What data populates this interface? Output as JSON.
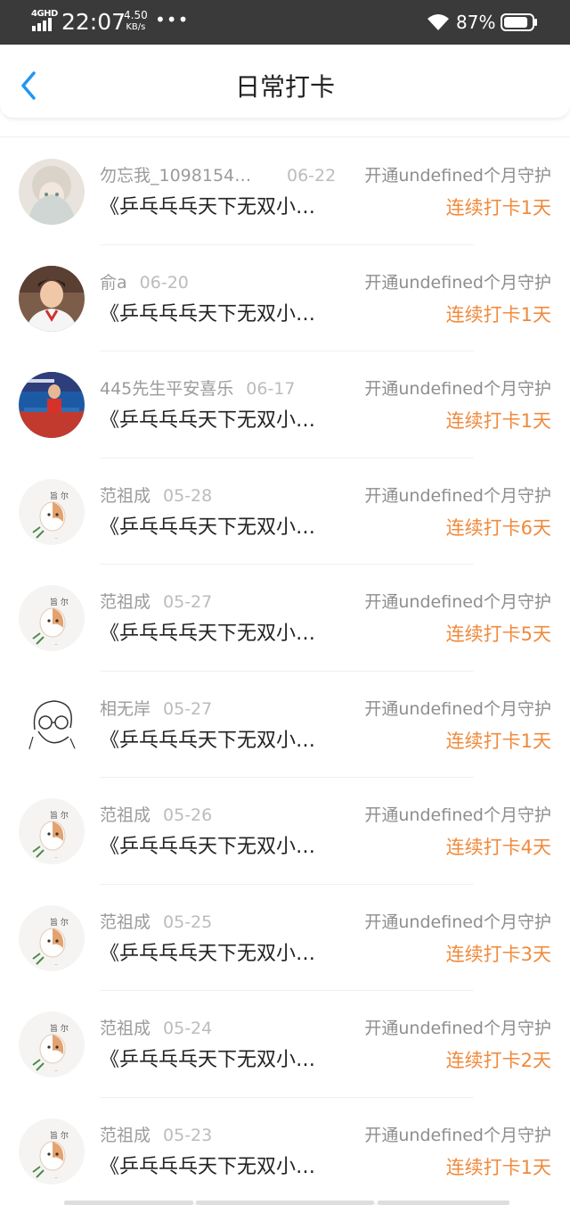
{
  "status_bar": {
    "network": "4GHD",
    "time": "22:07",
    "speed_value": "4.50",
    "speed_unit": "KB/s",
    "more": "•••",
    "battery": "87%",
    "battery_level": 0.87
  },
  "header": {
    "title": "日常打卡",
    "back_icon": "chevron-left-icon"
  },
  "colors": {
    "accent_blue": "#2196f3",
    "streak_orange": "#f08a3c"
  },
  "checkins": [
    {
      "user": "勿忘我_1098154…",
      "date": "06-22",
      "book": "《乒乓乓乓天下无双小…",
      "membership": "开通undefined个月守护",
      "streak": "连续打卡1天",
      "avatar": "anime-girl-avatar"
    },
    {
      "user": "俞a",
      "date": "06-20",
      "book": "《乒乓乓乓天下无双小…",
      "membership": "开通undefined个月守护",
      "streak": "连续打卡1天",
      "avatar": "boy-photo-avatar"
    },
    {
      "user": "445先生平安喜乐",
      "date": "06-17",
      "book": "《乒乓乓乓天下无双小…",
      "membership": "开通undefined个月守护",
      "streak": "连续打卡1天",
      "avatar": "table-tennis-avatar"
    },
    {
      "user": "范祖成",
      "date": "05-28",
      "book": "《乒乓乓乓天下无双小…",
      "membership": "开通undefined个月守护",
      "streak": "连续打卡6天",
      "avatar": "shiba-dog-avatar"
    },
    {
      "user": "范祖成",
      "date": "05-27",
      "book": "《乒乓乓乓天下无双小…",
      "membership": "开通undefined个月守护",
      "streak": "连续打卡5天",
      "avatar": "shiba-dog-avatar"
    },
    {
      "user": "相无岸",
      "date": "05-27",
      "book": "《乒乓乓乓天下无双小…",
      "membership": "开通undefined个月守护",
      "streak": "连续打卡1天",
      "avatar": "sketch-face-avatar"
    },
    {
      "user": "范祖成",
      "date": "05-26",
      "book": "《乒乓乓乓天下无双小…",
      "membership": "开通undefined个月守护",
      "streak": "连续打卡4天",
      "avatar": "shiba-dog-avatar"
    },
    {
      "user": "范祖成",
      "date": "05-25",
      "book": "《乒乓乓乓天下无双小…",
      "membership": "开通undefined个月守护",
      "streak": "连续打卡3天",
      "avatar": "shiba-dog-avatar"
    },
    {
      "user": "范祖成",
      "date": "05-24",
      "book": "《乒乓乓乓天下无双小…",
      "membership": "开通undefined个月守护",
      "streak": "连续打卡2天",
      "avatar": "shiba-dog-avatar"
    },
    {
      "user": "范祖成",
      "date": "05-23",
      "book": "《乒乓乓乓天下无双小…",
      "membership": "开通undefined个月守护",
      "streak": "连续打卡1天",
      "avatar": "shiba-dog-avatar"
    }
  ]
}
